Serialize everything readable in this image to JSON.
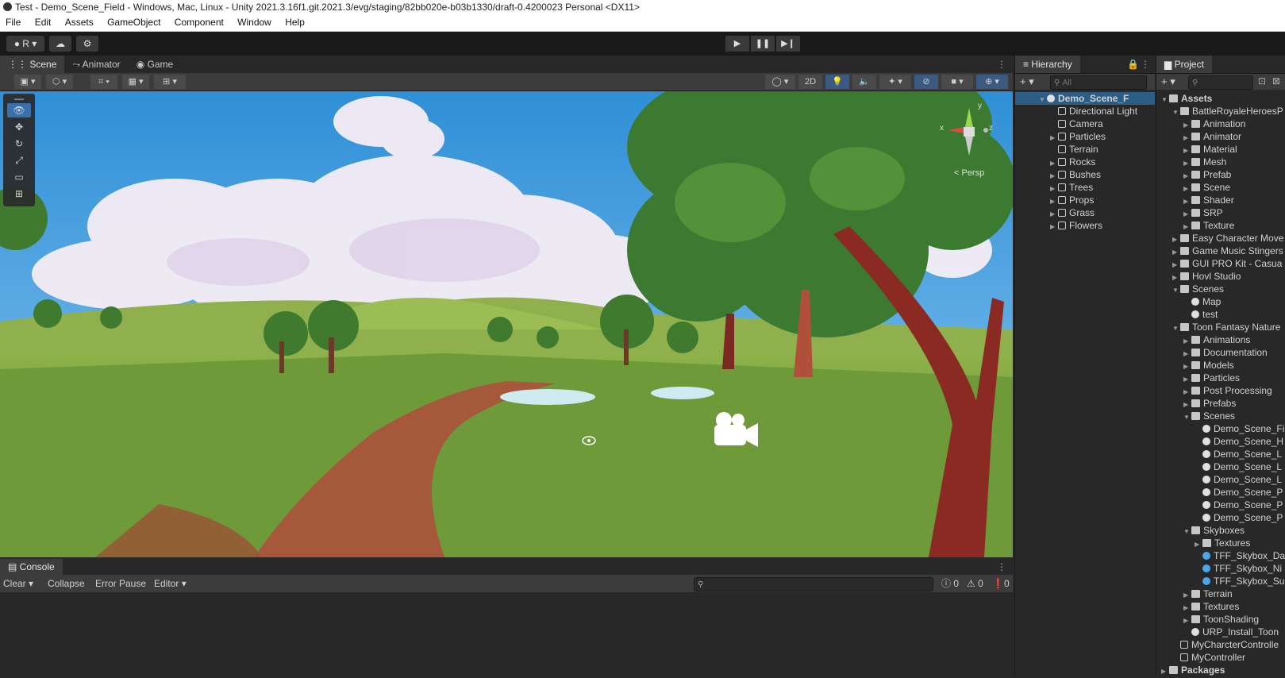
{
  "window": {
    "title": "Test - Demo_Scene_Field - Windows, Mac, Linux - Unity 2021.3.16f1.git.2021.3/evg/staging/82bb020e-b03b1330/draft-0.4200023 Personal <DX11>"
  },
  "menu": [
    "File",
    "Edit",
    "Assets",
    "GameObject",
    "Component",
    "Window",
    "Help"
  ],
  "toolbar": {
    "account_label": "R",
    "play_icon": "▶",
    "pause_icon": "❚❚",
    "step_icon": "▶❙"
  },
  "scene_tabs": [
    "Scene",
    "Animator",
    "Game"
  ],
  "scene_toolbar": {
    "mode_2d": "2D"
  },
  "gizmo": {
    "persp_label": "< Persp",
    "x": "x",
    "y": "y",
    "z": "z"
  },
  "console": {
    "tab": "Console",
    "clear": "Clear",
    "collapse": "Collapse",
    "error_pause": "Error Pause",
    "editor": "Editor",
    "count_log": "0",
    "count_warn": "0",
    "count_error": "0"
  },
  "hierarchy": {
    "tab": "Hierarchy",
    "search_placeholder": "All",
    "scene": "Demo_Scene_F",
    "items": [
      {
        "label": "Directional Light",
        "expandable": false
      },
      {
        "label": "Camera",
        "expandable": false
      },
      {
        "label": "Particles",
        "expandable": true
      },
      {
        "label": "Terrain",
        "expandable": false
      },
      {
        "label": "Rocks",
        "expandable": true
      },
      {
        "label": "Bushes",
        "expandable": true
      },
      {
        "label": "Trees",
        "expandable": true
      },
      {
        "label": "Props",
        "expandable": true
      },
      {
        "label": "Grass",
        "expandable": true
      },
      {
        "label": "Flowers",
        "expandable": true
      }
    ]
  },
  "project": {
    "tab": "Project",
    "items": [
      {
        "label": "Assets",
        "depth": 0,
        "icon": "folder",
        "open": true
      },
      {
        "label": "BattleRoyaleHeroesP",
        "depth": 1,
        "icon": "folder",
        "open": true
      },
      {
        "label": "Animation",
        "depth": 2,
        "icon": "folder"
      },
      {
        "label": "Animator",
        "depth": 2,
        "icon": "folder"
      },
      {
        "label": "Material",
        "depth": 2,
        "icon": "folder"
      },
      {
        "label": "Mesh",
        "depth": 2,
        "icon": "folder"
      },
      {
        "label": "Prefab",
        "depth": 2,
        "icon": "folder"
      },
      {
        "label": "Scene",
        "depth": 2,
        "icon": "folder"
      },
      {
        "label": "Shader",
        "depth": 2,
        "icon": "folder"
      },
      {
        "label": "SRP",
        "depth": 2,
        "icon": "folder"
      },
      {
        "label": "Texture",
        "depth": 2,
        "icon": "folder"
      },
      {
        "label": "Easy Character Move",
        "depth": 1,
        "icon": "folder"
      },
      {
        "label": "Game Music Stingers",
        "depth": 1,
        "icon": "folder"
      },
      {
        "label": "GUI PRO Kit - Casua",
        "depth": 1,
        "icon": "folder"
      },
      {
        "label": "Hovl Studio",
        "depth": 1,
        "icon": "folder"
      },
      {
        "label": "Scenes",
        "depth": 1,
        "icon": "folder",
        "open": true
      },
      {
        "label": "Map",
        "depth": 2,
        "icon": "unity",
        "leaf": true
      },
      {
        "label": "test",
        "depth": 2,
        "icon": "unity",
        "leaf": true
      },
      {
        "label": "Toon Fantasy Nature",
        "depth": 1,
        "icon": "folder",
        "open": true
      },
      {
        "label": "Animations",
        "depth": 2,
        "icon": "folder"
      },
      {
        "label": "Documentation",
        "depth": 2,
        "icon": "folder"
      },
      {
        "label": "Models",
        "depth": 2,
        "icon": "folder"
      },
      {
        "label": "Particles",
        "depth": 2,
        "icon": "folder"
      },
      {
        "label": "Post Processing",
        "depth": 2,
        "icon": "folder"
      },
      {
        "label": "Prefabs",
        "depth": 2,
        "icon": "folder"
      },
      {
        "label": "Scenes",
        "depth": 2,
        "icon": "folder",
        "open": true
      },
      {
        "label": "Demo_Scene_Fi",
        "depth": 3,
        "icon": "unity",
        "leaf": true
      },
      {
        "label": "Demo_Scene_H",
        "depth": 3,
        "icon": "unity",
        "leaf": true
      },
      {
        "label": "Demo_Scene_L",
        "depth": 3,
        "icon": "unity",
        "leaf": true
      },
      {
        "label": "Demo_Scene_L",
        "depth": 3,
        "icon": "unity",
        "leaf": true
      },
      {
        "label": "Demo_Scene_L",
        "depth": 3,
        "icon": "unity",
        "leaf": true
      },
      {
        "label": "Demo_Scene_P",
        "depth": 3,
        "icon": "unity",
        "leaf": true
      },
      {
        "label": "Demo_Scene_P",
        "depth": 3,
        "icon": "unity",
        "leaf": true
      },
      {
        "label": "Demo_Scene_P",
        "depth": 3,
        "icon": "unity",
        "leaf": true
      },
      {
        "label": "Skyboxes",
        "depth": 2,
        "icon": "folder",
        "open": true
      },
      {
        "label": "Textures",
        "depth": 3,
        "icon": "folder"
      },
      {
        "label": "TFF_Skybox_Da",
        "depth": 3,
        "icon": "sky",
        "leaf": true
      },
      {
        "label": "TFF_Skybox_Ni",
        "depth": 3,
        "icon": "sky",
        "leaf": true
      },
      {
        "label": "TFF_Skybox_Su",
        "depth": 3,
        "icon": "sky",
        "leaf": true
      },
      {
        "label": "Terrain",
        "depth": 2,
        "icon": "folder"
      },
      {
        "label": "Textures",
        "depth": 2,
        "icon": "folder"
      },
      {
        "label": "ToonShading",
        "depth": 2,
        "icon": "folder"
      },
      {
        "label": "URP_Install_Toon",
        "depth": 2,
        "icon": "unity",
        "leaf": true
      },
      {
        "label": "MyCharcterControlle",
        "depth": 1,
        "icon": "script",
        "leaf": true
      },
      {
        "label": "MyController",
        "depth": 1,
        "icon": "script",
        "leaf": true
      },
      {
        "label": "Packages",
        "depth": 0,
        "icon": "folder"
      }
    ]
  },
  "colors": {
    "accent": "#2c5d87",
    "sky_top": "#2f8fd6",
    "grass": "#5c8a32",
    "dirt": "#a5593a"
  }
}
